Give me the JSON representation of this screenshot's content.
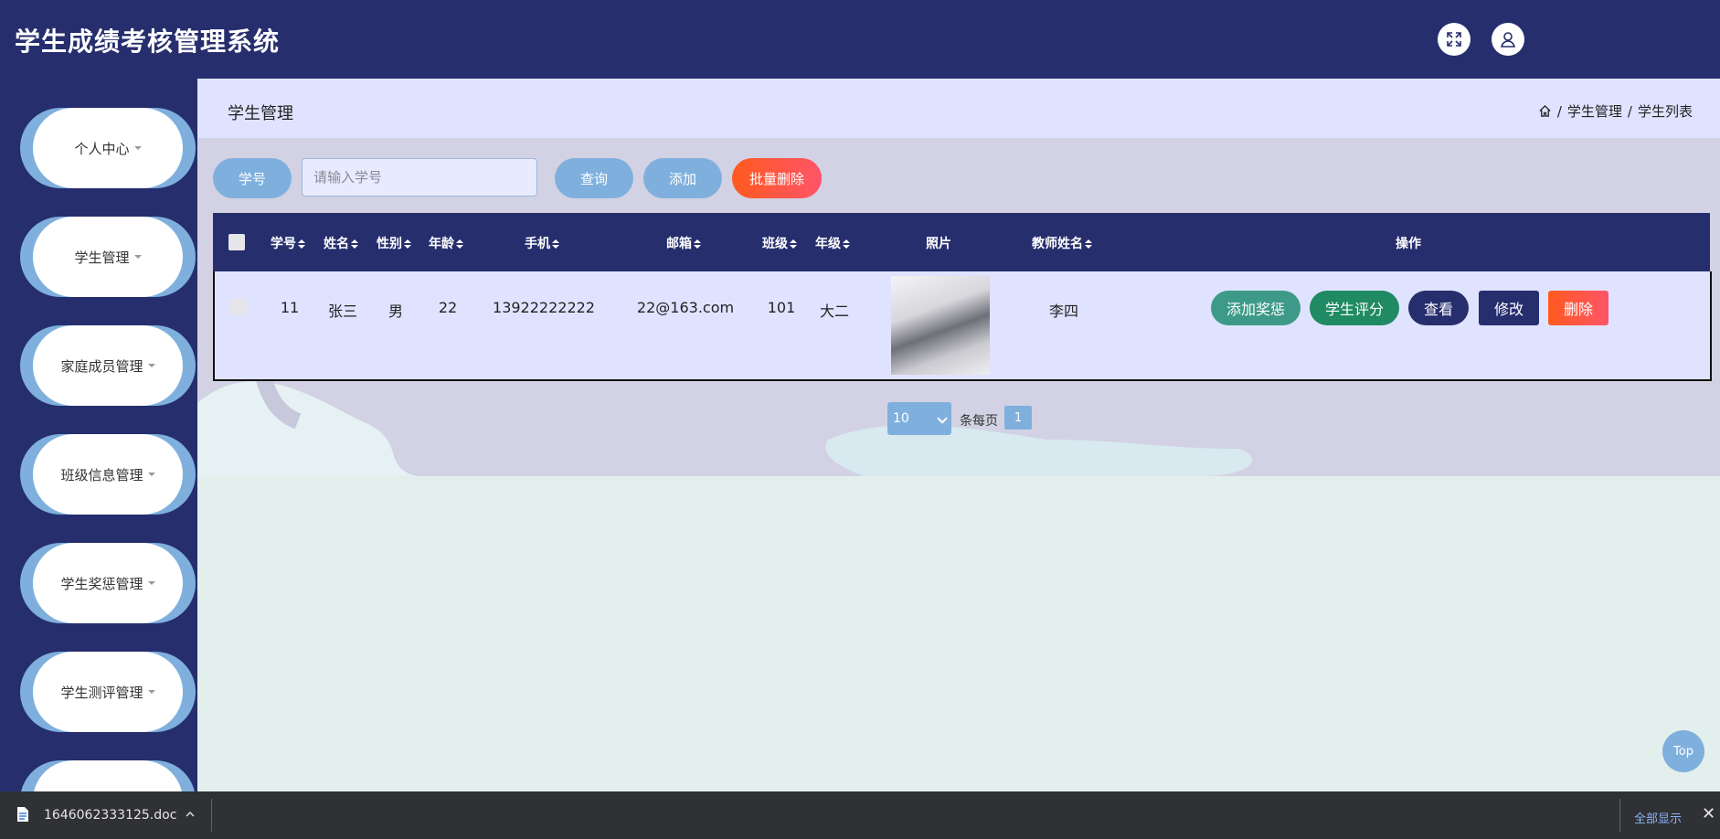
{
  "header": {
    "title": "学生成绩考核管理系统",
    "fullscreen_icon": "expand-icon",
    "user_icon": "user-icon"
  },
  "sidebar": {
    "items": [
      {
        "label": "个人中心"
      },
      {
        "label": "学生管理"
      },
      {
        "label": "家庭成员管理"
      },
      {
        "label": "班级信息管理"
      },
      {
        "label": "学生奖惩管理"
      },
      {
        "label": "学生测评管理"
      },
      {
        "label": ""
      }
    ]
  },
  "breadcrumb": {
    "title": "学生管理",
    "path": [
      "学生管理",
      "学生列表"
    ],
    "separator": "/"
  },
  "search": {
    "label": "学号",
    "placeholder": "请输入学号",
    "value": "",
    "query_label": "查询",
    "add_label": "添加",
    "batch_delete_label": "批量删除"
  },
  "table": {
    "headers": [
      "学号",
      "姓名",
      "性别",
      "年龄",
      "手机",
      "邮箱",
      "班级",
      "年级",
      "照片",
      "教师姓名",
      "操作"
    ],
    "rows": [
      {
        "student_id": "11",
        "name": "张三",
        "gender": "男",
        "age": "22",
        "phone": "13922222222",
        "email": "22@163.com",
        "class": "101",
        "grade": "大二",
        "teacher": "李四"
      }
    ],
    "actions": {
      "add_reward": "添加奖惩",
      "evaluate": "学生评分",
      "view": "查看",
      "edit": "修改",
      "delete": "删除"
    }
  },
  "pagination": {
    "page_size": "10",
    "per_page_label": "条每页",
    "current_page": "1"
  },
  "back_to_top": "Top",
  "download_bar": {
    "file_name": "1646062333125.doc",
    "show_all": "全部显示",
    "close": "✕"
  },
  "colors": {
    "navy": "#262e6e",
    "light_blue": "#7fb0dd",
    "red": "#ff5a4a",
    "teal": "#3d9a88",
    "green": "#1f8a63"
  }
}
